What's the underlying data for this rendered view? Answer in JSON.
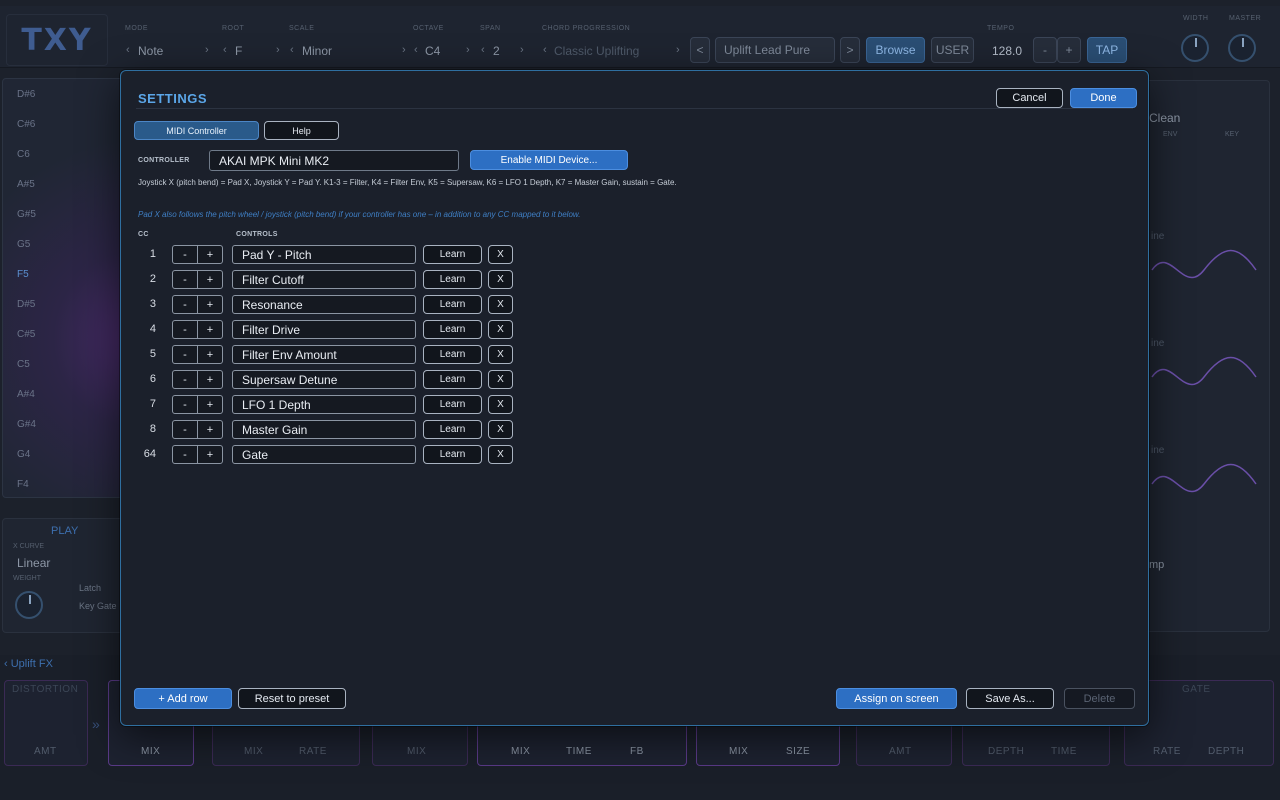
{
  "background": {
    "logo": "TXY",
    "topbar": [
      {
        "label": "MODE",
        "value": "Note"
      },
      {
        "label": "ROOT",
        "value": "F"
      },
      {
        "label": "SCALE",
        "value": "Minor"
      },
      {
        "label": "OCTAVE",
        "value": "C4"
      },
      {
        "label": "SPAN",
        "value": "2"
      },
      {
        "label": "CHORD PROGRESSION",
        "value": "Classic Uplifting"
      },
      {
        "label": "TEMPO",
        "value": "128.0"
      }
    ],
    "preset_name": "Uplift Lead Pure",
    "prev_label": "<",
    "next_label": ">",
    "browse_label": "Browse",
    "user_label": "USER",
    "tempo_minus": "-",
    "tempo_plus": "+",
    "tap_label": "TAP",
    "width_label": "WIDTH",
    "master_label": "MASTER",
    "notes": [
      "D#6",
      "C#6",
      "C6",
      "A#5",
      "G#5",
      "G5",
      "F5",
      "D#5",
      "C#5",
      "C5",
      "A#4",
      "G#4",
      "G4",
      "F4"
    ],
    "active_note": "F5",
    "play": {
      "title": "PLAY",
      "xcurve_label": "X CURVE",
      "xcurve_value": "Linear",
      "weight_label": "WEIGHT",
      "latch_label": "Latch",
      "keygate_label": "Key Gate"
    },
    "right": {
      "drive_value": "Clean",
      "env_label": "ENV",
      "key_label": "KEY",
      "lfo_shape": "ine",
      "amp_label": "mp"
    },
    "fx": {
      "section_title": "Uplift FX",
      "distortion_title": "DISTORTION",
      "gate_title": "GATE",
      "labels": [
        "AMT",
        "MIX",
        "MIX",
        "RATE",
        "MIX",
        "MIX",
        "TIME",
        "FB",
        "MIX",
        "SIZE",
        "AMT",
        "DEPTH",
        "TIME",
        "RATE",
        "DEPTH"
      ]
    }
  },
  "dialog": {
    "title": "SETTINGS",
    "cancel_label": "Cancel",
    "done_label": "Done",
    "tabs": [
      "MIDI Controller",
      "Help"
    ],
    "controller_label": "CONTROLLER",
    "controller_value": "AKAI MPK Mini MK2",
    "enable_label": "Enable MIDI Device...",
    "mapping_note": "Joystick X (pitch bend) = Pad X, Joystick Y = Pad Y. K1-3 = Filter, K4 = Filter Env, K5 = Supersaw, K6 = LFO 1 Depth, K7 = Master Gain, sustain = Gate.",
    "pitch_note": "Pad X also follows the pitch wheel / joystick (pitch bend) if your controller has one – in addition to any CC mapped to it below.",
    "cc_header": "CC",
    "controls_header": "CONTROLS",
    "minus": "-",
    "plus": "+",
    "learn_label": "Learn",
    "remove_label": "X",
    "rows": [
      {
        "cc": "1",
        "control": "Pad Y - Pitch"
      },
      {
        "cc": "2",
        "control": "Filter Cutoff"
      },
      {
        "cc": "3",
        "control": "Resonance"
      },
      {
        "cc": "4",
        "control": "Filter Drive"
      },
      {
        "cc": "5",
        "control": "Filter Env Amount"
      },
      {
        "cc": "6",
        "control": "Supersaw Detune"
      },
      {
        "cc": "7",
        "control": "LFO 1 Depth"
      },
      {
        "cc": "8",
        "control": "Master Gain"
      },
      {
        "cc": "64",
        "control": "Gate"
      }
    ],
    "add_row_label": "+ Add row",
    "reset_label": "Reset to preset",
    "assign_label": "Assign on screen",
    "save_as_label": "Save As...",
    "delete_label": "Delete"
  },
  "colors": {
    "accent": "#2d6fc3",
    "title": "#5ba6e8",
    "dialog_border": "#2f6fa0"
  }
}
